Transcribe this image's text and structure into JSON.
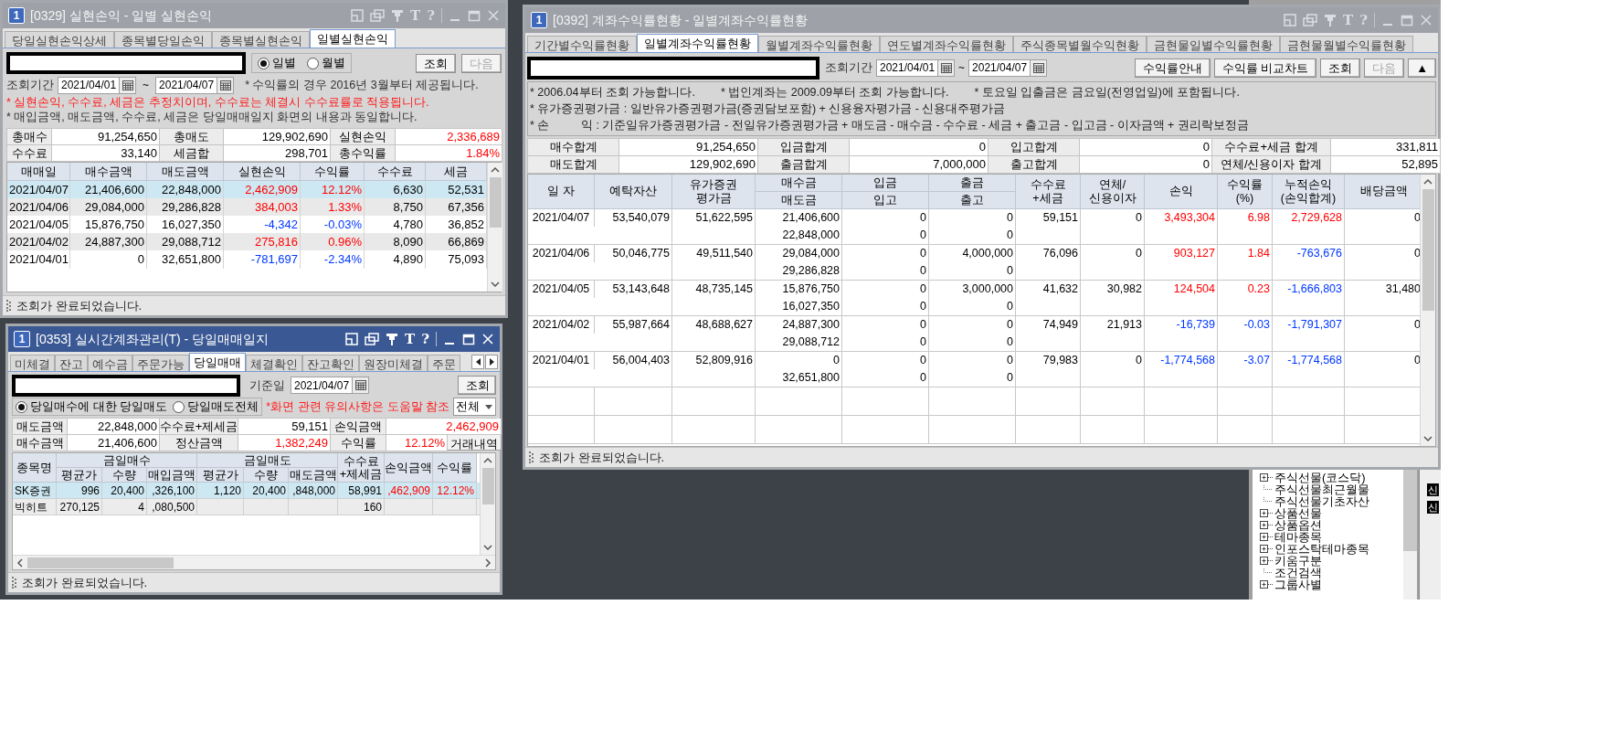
{
  "realized_pnl_window": {
    "badge": "1",
    "title": "[0329] 실현손익 - 일별 실현손익",
    "title_glyphs": [
      "T",
      "?"
    ],
    "active": false,
    "tabs": [
      {
        "label": "당일실현손익상세",
        "selected": false
      },
      {
        "label": "종목별당일손익",
        "selected": false
      },
      {
        "label": "종목별실현손익",
        "selected": false
      },
      {
        "label": "일별실현손익",
        "selected": true
      }
    ],
    "view_modes": [
      {
        "label": "일별",
        "selected": true
      },
      {
        "label": "월별",
        "selected": false
      }
    ],
    "buttons": [
      {
        "label": "조회",
        "disabled": false
      },
      {
        "label": "다음",
        "disabled": true
      }
    ],
    "period_label": "조회기간",
    "date_from": "2021/04/01",
    "date_separator": "~",
    "date_to": "2021/04/07",
    "period_note": "* 수익률의 경우 2016년 3월부터 제공됩니다.",
    "notes": [
      {
        "kind": "warning",
        "text": "* 실현손익, 수수료, 세금은 추정치이며, 수수료는 체결시 수수료률로 적용됩니다."
      },
      {
        "kind": "info",
        "text": "* 매입금액, 매도금액, 수수료, 세금은 당일매매일지 화면의 내용과 동일합니다."
      }
    ],
    "summary": [
      [
        {
          "label": "총매수",
          "value": "91,254,650",
          "kind": "plain"
        },
        {
          "label": "총매도",
          "value": "129,902,690",
          "kind": "plain"
        },
        {
          "label": "실현손익",
          "value": "2,336,689",
          "kind": "gain"
        }
      ],
      [
        {
          "label": "수수료",
          "value": "33,140",
          "kind": "plain"
        },
        {
          "label": "세금합",
          "value": "298,701",
          "kind": "plain"
        },
        {
          "label": "총수익률",
          "value": "1.84%",
          "kind": "gain"
        }
      ]
    ],
    "columns": [
      "매매일",
      "매수금액",
      "매도금액",
      "실현손익",
      "수익률",
      "수수료",
      "세금"
    ],
    "rows": [
      {
        "selected": true,
        "loss": false,
        "cells": [
          "2021/04/07",
          "21,406,600",
          "22,848,000",
          "2,462,909",
          "12.12%",
          "6,630",
          "52,531"
        ]
      },
      {
        "selected": false,
        "loss": false,
        "cells": [
          "2021/04/06",
          "29,084,000",
          "29,286,828",
          "384,003",
          "1.33%",
          "8,750",
          "67,356"
        ]
      },
      {
        "selected": false,
        "loss": true,
        "cells": [
          "2021/04/05",
          "15,876,750",
          "16,027,350",
          "-4,342",
          "-0.03%",
          "4,780",
          "36,852"
        ]
      },
      {
        "selected": false,
        "loss": false,
        "cells": [
          "2021/04/02",
          "24,887,300",
          "29,088,712",
          "275,816",
          "0.96%",
          "8,090",
          "66,869"
        ]
      },
      {
        "selected": false,
        "loss": true,
        "cells": [
          "2021/04/01",
          "0",
          "32,651,800",
          "-781,697",
          "-2.34%",
          "4,890",
          "75,093"
        ]
      }
    ],
    "status": "조회가 완료되었습니다."
  },
  "trading_journal_window": {
    "badge": "1",
    "title": "[0353] 실시간계좌관리(T) - 당일매매일지",
    "title_glyphs": [
      "T",
      "?"
    ],
    "active": true,
    "tabs": [
      {
        "label": "미체결",
        "selected": false
      },
      {
        "label": "잔고",
        "selected": false
      },
      {
        "label": "예수금",
        "selected": false
      },
      {
        "label": "주문가능",
        "selected": false
      },
      {
        "label": "당일매매",
        "selected": true
      },
      {
        "label": "체결확인",
        "selected": false
      },
      {
        "label": "잔고확인",
        "selected": false
      },
      {
        "label": "원장미체결",
        "selected": false
      },
      {
        "label": "주문",
        "selected": false
      }
    ],
    "date_label": "기준일",
    "date": "2021/04/07",
    "query_button": "조회",
    "scope_options": [
      {
        "label": "당일매수에 대한 당일매도",
        "selected": true
      },
      {
        "label": "당일매도전체",
        "selected": false
      }
    ],
    "help_note": "*화면 관련 유의사항은 도움말 참조",
    "filter": "전체",
    "summary": [
      [
        {
          "label": "매도금액",
          "value": "22,848,000",
          "kind": "plain"
        },
        {
          "label": "수수료+제세금",
          "value": "59,151",
          "kind": "plain"
        },
        {
          "label": "손익금액",
          "value": "2,462,909",
          "kind": "gain"
        }
      ],
      [
        {
          "label": "매수금액",
          "value": "21,406,600",
          "kind": "plain"
        },
        {
          "label": "정산금액",
          "value": "1,382,249",
          "kind": "gain"
        },
        {
          "label": "수익률",
          "value": "12.12%",
          "kind": "gain"
        }
      ]
    ],
    "trade_history_button": "거래내역",
    "grid_header": [
      {
        "label": "종목명"
      },
      {
        "label": "금일매수",
        "children": [
          "평균가",
          "수량",
          "매입금액"
        ]
      },
      {
        "label": "금일매도",
        "children": [
          "평균가",
          "수량",
          "매도금액"
        ]
      },
      {
        "label": "수수료\n+제세금"
      },
      {
        "label": "손익금액"
      },
      {
        "label": "수익률"
      }
    ],
    "rows": [
      {
        "selected": true,
        "loss": false,
        "cells": [
          "SK증권",
          "996",
          "20,400",
          ",326,100",
          "1,120",
          "20,400",
          ",848,000",
          "58,991",
          ",462,909",
          "12.12%"
        ]
      },
      {
        "selected": false,
        "cells": [
          "빅히트",
          "270,125",
          "4",
          ",080,500",
          null,
          null,
          null,
          "160",
          null,
          null
        ]
      }
    ],
    "status": "조회가 완료되었습니다."
  },
  "account_return_window": {
    "badge": "1",
    "title": "[0392] 계좌수익률현황 - 일별계좌수익률현황",
    "title_glyphs": [
      "T",
      "?"
    ],
    "active": false,
    "tabs": [
      {
        "label": "기간별수익률현황",
        "selected": false
      },
      {
        "label": "일별계좌수익률현황",
        "selected": true
      },
      {
        "label": "월별계좌수익률현황",
        "selected": false
      },
      {
        "label": "연도별계좌수익률현황",
        "selected": false
      },
      {
        "label": "주식종목별월수익현황",
        "selected": false
      },
      {
        "label": "금현물일별수익률현황",
        "selected": false
      },
      {
        "label": "금현물월별수익률현황",
        "selected": false
      }
    ],
    "period_label": "조회기간",
    "date_from": "2021/04/01",
    "date_separator": "~",
    "date_to": "2021/04/07",
    "buttons": [
      {
        "label": "수익률안내",
        "disabled": false
      },
      {
        "label": "수익률 비교차트",
        "disabled": false
      },
      {
        "label": "조회",
        "disabled": false
      },
      {
        "label": "다음",
        "disabled": true
      },
      {
        "label": "▲",
        "disabled": false
      }
    ],
    "notes": [
      [
        "* 2006.04부터 조회 가능합니다.",
        "* 법인계좌는 2009.09부터 조회 가능합니다.",
        "* 토요일 입출금은 금요일(전영업일)에 포함됩니다."
      ],
      [
        "* 유가증권평가금 : 일반유가증권평가금(증권담보포함) + 신용융자평가금 - 신용대주평가금"
      ],
      [
        "* 손          익 : 기준일유가증권평가금 - 전일유가증권평가금 + 매도금 - 매수금 - 수수료 - 세금 + 출고금 - 입고금 - 이자금액 + 권리락보정금"
      ]
    ],
    "summary": [
      [
        {
          "label": "매수합계",
          "value": "91,254,650"
        },
        {
          "label": "입금합계",
          "value": "0"
        },
        {
          "label": "입고합계",
          "value": "0"
        },
        {
          "label": "수수료+세금 합계",
          "value": "331,811"
        }
      ],
      [
        {
          "label": "매도합계",
          "value": "129,902,690"
        },
        {
          "label": "출금합계",
          "value": "7,000,000"
        },
        {
          "label": "출고합계",
          "value": "0"
        },
        {
          "label": "연체/신용이자 합계",
          "value": "52,895"
        }
      ]
    ],
    "grid_header": [
      {
        "label": "일 자"
      },
      {
        "label": "예탁자산"
      },
      {
        "label": "유가증권\n평가금"
      },
      {
        "label": "매수금",
        "sub_label": "매도금"
      },
      {
        "label": "입금",
        "sub_label": "입고"
      },
      {
        "label": "출금",
        "sub_label": "출고"
      },
      {
        "label": "수수료\n+세금"
      },
      {
        "label": "연체/\n신용이자"
      },
      {
        "label": "손익"
      },
      {
        "label": "수익률\n(%)"
      },
      {
        "label": "누적손익\n(손익합계)"
      },
      {
        "label": "배당금액"
      }
    ],
    "rows": [
      {
        "date": "2021/04/07",
        "deposit_assets": "53,540,079",
        "securities_value": "51,622,595",
        "buy": "21,406,600",
        "sell": "22,848,000",
        "cash_in": "0",
        "stock_in": "0",
        "cash_out": "0",
        "stock_out": "0",
        "fees_tax": "59,151",
        "interest": "0",
        "pnl": "3,493,304",
        "pnl_rate": "6.98",
        "pnl_loss": false,
        "cumulative": "2,729,628",
        "cumulative_loss": false,
        "dividend": "0"
      },
      {
        "date": "2021/04/06",
        "deposit_assets": "50,046,775",
        "securities_value": "49,511,540",
        "buy": "29,084,000",
        "sell": "29,286,828",
        "cash_in": "0",
        "stock_in": "0",
        "cash_out": "4,000,000",
        "stock_out": "0",
        "fees_tax": "76,096",
        "interest": "0",
        "pnl": "903,127",
        "pnl_rate": "1.84",
        "pnl_loss": false,
        "cumulative": "-763,676",
        "cumulative_loss": true,
        "dividend": "0"
      },
      {
        "date": "2021/04/05",
        "deposit_assets": "53,143,648",
        "securities_value": "48,735,145",
        "buy": "15,876,750",
        "sell": "16,027,350",
        "cash_in": "0",
        "stock_in": "0",
        "cash_out": "3,000,000",
        "stock_out": "0",
        "fees_tax": "41,632",
        "interest": "30,982",
        "pnl": "124,504",
        "pnl_rate": "0.23",
        "pnl_loss": false,
        "cumulative": "-1,666,803",
        "cumulative_loss": true,
        "dividend": "31,480"
      },
      {
        "date": "2021/04/02",
        "deposit_assets": "55,987,664",
        "securities_value": "48,688,627",
        "buy": "24,887,300",
        "sell": "29,088,712",
        "cash_in": "0",
        "stock_in": "0",
        "cash_out": "0",
        "stock_out": "0",
        "fees_tax": "74,949",
        "interest": "21,913",
        "pnl": "-16,739",
        "pnl_rate": "-0.03",
        "pnl_loss": true,
        "cumulative": "-1,791,307",
        "cumulative_loss": true,
        "dividend": "0"
      },
      {
        "date": "2021/04/01",
        "deposit_assets": "56,004,403",
        "securities_value": "52,809,916",
        "buy": "0",
        "sell": "32,651,800",
        "cash_in": "0",
        "stock_in": "0",
        "cash_out": "0",
        "stock_out": "0",
        "fees_tax": "79,983",
        "interest": "0",
        "pnl": "-1,774,568",
        "pnl_rate": "-3.07",
        "pnl_loss": true,
        "cumulative": "-1,774,568",
        "cumulative_loss": true,
        "dividend": "0"
      }
    ],
    "status": "조회가 완료되었습니다."
  },
  "market_tree_panel": {
    "items": [
      {
        "label": "주식선물(코스닥)",
        "kind": "folder"
      },
      {
        "label": "주식선물최근월물",
        "kind": "leaf"
      },
      {
        "label": "주식선물기초자산",
        "kind": "leaf"
      },
      {
        "label": "상품선물",
        "kind": "folder"
      },
      {
        "label": "상품옵션",
        "kind": "folder"
      },
      {
        "label": "테마종목",
        "kind": "folder"
      },
      {
        "label": "인포스탁테마종목",
        "kind": "folder"
      },
      {
        "label": "키움구분",
        "kind": "folder"
      },
      {
        "label": "조건검색",
        "kind": "leaf"
      },
      {
        "label": "그룹사별",
        "kind": "folder"
      }
    ],
    "badges": [
      "신",
      "신"
    ]
  }
}
